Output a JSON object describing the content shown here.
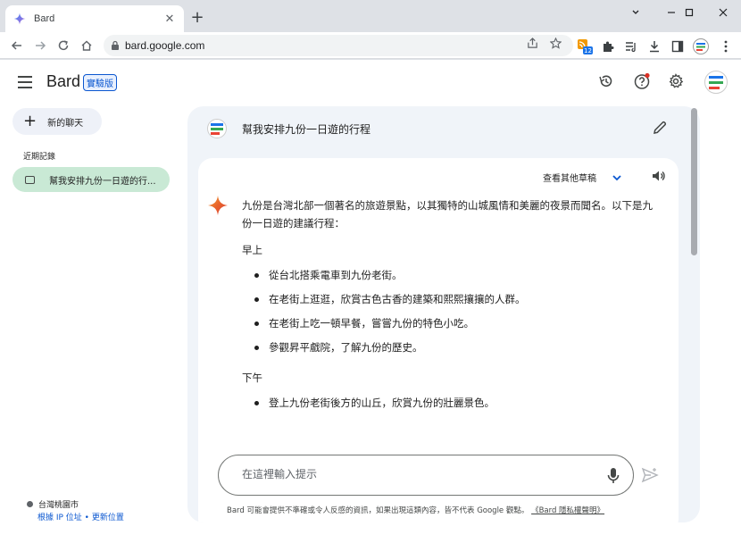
{
  "browser": {
    "tab_title": "Bard",
    "tab_close": "✕",
    "new_tab": "+",
    "url": "bard.google.com",
    "extension_badge": "12"
  },
  "header": {
    "brand": "Bard",
    "badge": "實驗版"
  },
  "sidebar": {
    "new_chat_label": "新的聊天",
    "recent_heading": "近期記錄",
    "recent_items": [
      {
        "label": "幫我安排九份一日遊的行..."
      }
    ],
    "location": {
      "place": "台灣桃園市",
      "ip_link": "根據 IP 位址",
      "separator": " • ",
      "update_link": "更新位置"
    }
  },
  "conversation": {
    "query": "幫我安排九份一日遊的行程",
    "drafts_label": "查看其他草稿",
    "answer": {
      "intro": "九份是台灣北部一個著名的旅遊景點，以其獨特的山城風情和美麗的夜景而聞名。以下是九份一日遊的建議行程：",
      "sections": [
        {
          "heading": "早上",
          "items": [
            "從台北搭乘電車到九份老街。",
            "在老街上逛逛，欣賞古色古香的建築和熙熙攘攘的人群。",
            "在老街上吃一頓早餐，嘗嘗九份的特色小吃。",
            "參觀昇平戲院，了解九份的歷史。"
          ]
        },
        {
          "heading": "下午",
          "items": [
            "登上九份老街後方的山丘，欣賞九份的壯麗景色。"
          ]
        }
      ]
    }
  },
  "input": {
    "placeholder": "在這裡輸入提示"
  },
  "footer": {
    "disclaimer": "Bard 可能會提供不準確或令人反感的資訊，如果出現這類內容，皆不代表 Google 觀點。",
    "privacy_link": "《Bard 隱私權聲明》"
  },
  "colors": {
    "accent": "#0b57d0",
    "selected_item": "#c9e9d5",
    "main_panel": "#f0f4f9"
  }
}
